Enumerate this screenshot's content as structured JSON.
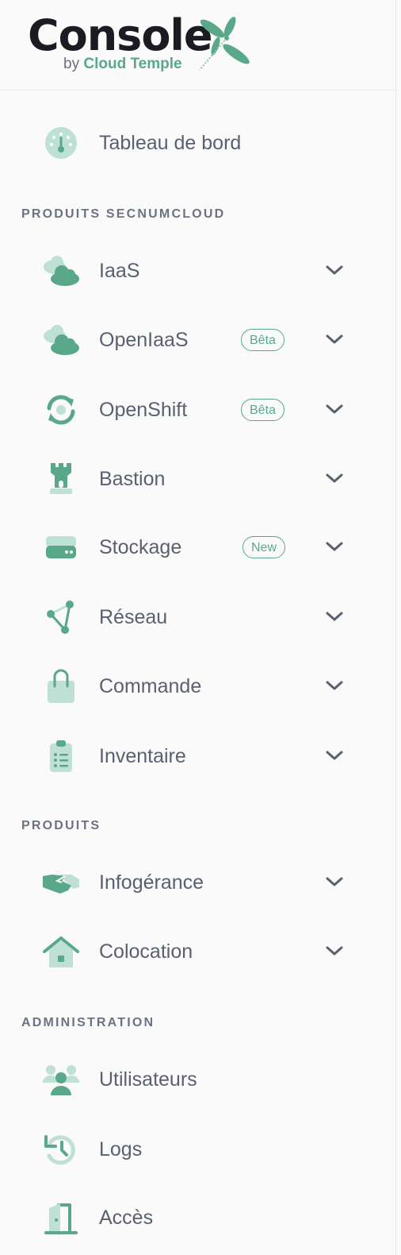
{
  "brand": {
    "name": "Console",
    "by": "by",
    "company": "Cloud Temple"
  },
  "colors": {
    "accent": "#5aa88a",
    "accent_light": "#bfe0d4",
    "text": "#5a6070",
    "section": "#6b7383"
  },
  "nav": {
    "dashboard": {
      "label": "Tableau de bord",
      "icon": "gauge-icon"
    },
    "sections": [
      {
        "title": "PRODUITS SECNUMCLOUD"
      },
      {
        "title": "PRODUITS"
      },
      {
        "title": "ADMINISTRATION"
      }
    ],
    "secnum": [
      {
        "label": "IaaS",
        "icon": "cloud-icon"
      },
      {
        "label": "OpenIaaS",
        "icon": "cloud-icon",
        "badge": "Bêta"
      },
      {
        "label": "OpenShift",
        "icon": "refresh-icon",
        "badge": "Bêta"
      },
      {
        "label": "Bastion",
        "icon": "tower-icon"
      },
      {
        "label": "Stockage",
        "icon": "storage-icon",
        "badge": "New"
      },
      {
        "label": "Réseau",
        "icon": "network-icon"
      },
      {
        "label": "Commande",
        "icon": "bag-icon"
      },
      {
        "label": "Inventaire",
        "icon": "clipboard-icon"
      }
    ],
    "produits": [
      {
        "label": "Infogérance",
        "icon": "handshake-icon"
      },
      {
        "label": "Colocation",
        "icon": "house-icon"
      }
    ],
    "admin": [
      {
        "label": "Utilisateurs",
        "icon": "users-icon"
      },
      {
        "label": "Logs",
        "icon": "history-icon"
      },
      {
        "label": "Accès",
        "icon": "door-icon"
      }
    ]
  }
}
